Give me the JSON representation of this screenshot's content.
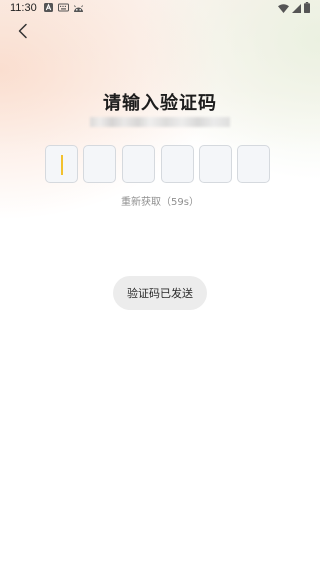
{
  "status_bar": {
    "time": "11:30",
    "left_icons": [
      "a-square-icon",
      "keyboard-icon",
      "android-icon"
    ],
    "right_icons": [
      "wifi-icon",
      "signal-icon",
      "battery-icon"
    ]
  },
  "header": {
    "back_icon": "chevron-left-icon"
  },
  "verification": {
    "title": "请输入验证码",
    "phone_number_masked": "",
    "code_length": 6,
    "resend_label": "重新获取（59s）"
  },
  "toast": {
    "message": "验证码已发送"
  },
  "colors": {
    "cursor": "#f2c12e",
    "box_border": "#d5d9de",
    "box_fill": "#f4f6f9",
    "title": "#1d1d1d",
    "muted_text": "#8f8f8f",
    "toast_bg": "#ececec"
  }
}
